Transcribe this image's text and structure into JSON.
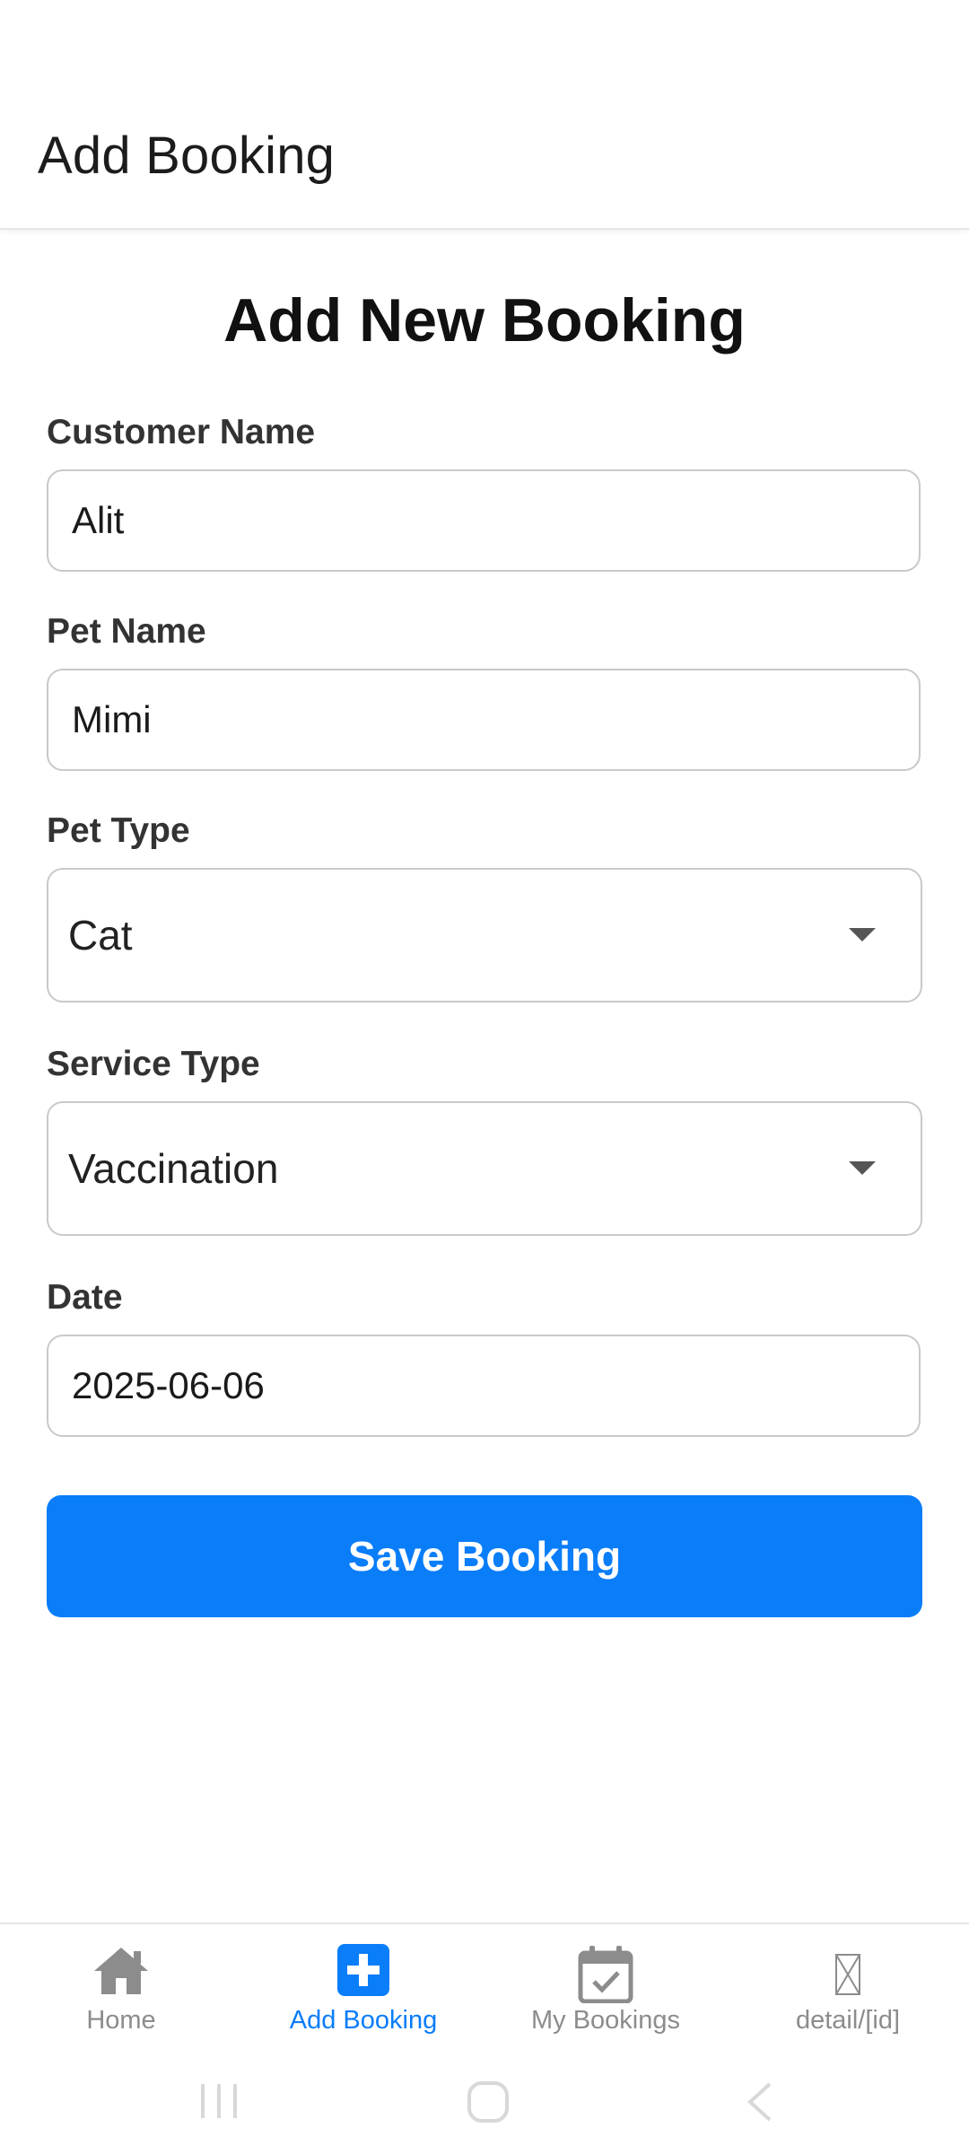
{
  "header": {
    "title": "Add Booking"
  },
  "form": {
    "title": "Add New Booking",
    "customer_name": {
      "label": "Customer Name",
      "value": "Alit"
    },
    "pet_name": {
      "label": "Pet Name",
      "value": "Mimi"
    },
    "pet_type": {
      "label": "Pet Type",
      "selected": "Cat"
    },
    "service_type": {
      "label": "Service Type",
      "selected": "Vaccination"
    },
    "date": {
      "label": "Date",
      "value": "2025-06-06"
    },
    "save_label": "Save Booking"
  },
  "tabs": [
    {
      "label": "Home",
      "icon": "home-icon",
      "active": false
    },
    {
      "label": "Add Booking",
      "icon": "plus-square-icon",
      "active": true
    },
    {
      "label": "My Bookings",
      "icon": "calendar-check-icon",
      "active": false
    },
    {
      "label": "detail/[id]",
      "icon": "missing-image-icon",
      "active": false
    }
  ],
  "colors": {
    "accent": "#0a7df9",
    "inactive": "#8c8c8c",
    "border": "#c9c9c9"
  }
}
